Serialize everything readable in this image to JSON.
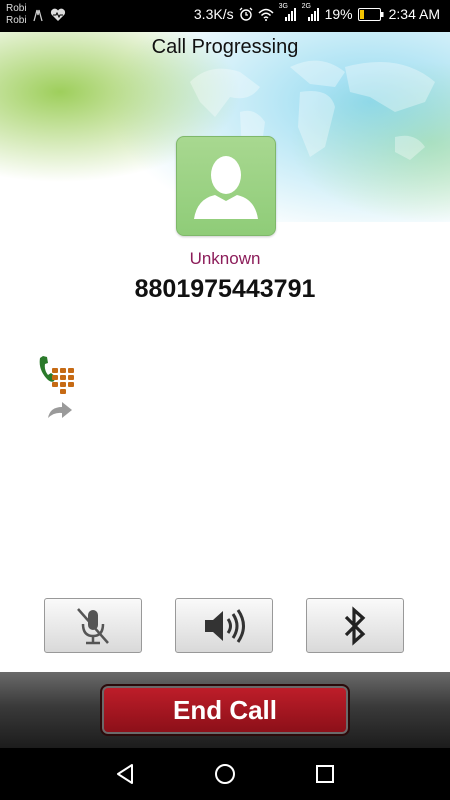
{
  "status_bar": {
    "carrier_line1": "Robi",
    "carrier_line2": "Robi",
    "speed": "3.3K/s",
    "signal1_label": "3G",
    "signal2_label": "2G",
    "battery_percent": "19%",
    "time": "2:34 AM"
  },
  "call": {
    "title": "Call Progressing",
    "contact_name": "Unknown",
    "phone_number": "8801975443791"
  },
  "controls": {
    "mute_icon": "mic-muted-icon",
    "speaker_icon": "speaker-icon",
    "bluetooth_icon": "bluetooth-icon"
  },
  "end_call_label": "End Call",
  "colors": {
    "contact_name": "#8c1d5a",
    "end_call": "#a8151f",
    "avatar_bg": "#9fd488"
  }
}
